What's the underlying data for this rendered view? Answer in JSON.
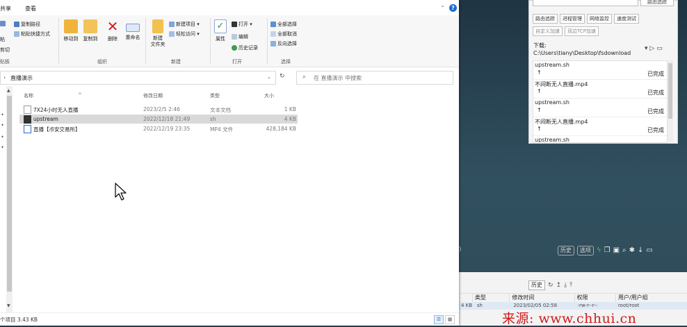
{
  "explorer": {
    "tabs": [
      "共享",
      "查看"
    ],
    "ribbon": {
      "clipboard": {
        "copy_path": "复制路径",
        "paste_shortcut": "粘贴快捷方式",
        "paste_frag": "粘",
        "cut_frag": "剪切",
        "label": "贴板"
      },
      "organize": {
        "move_to": "移动到",
        "copy_to": "复制到",
        "delete": "删除",
        "rename": "重命名",
        "label": "组织"
      },
      "new": {
        "new_item": "新建项目 ▾",
        "easy_access": "轻松访问 ▾",
        "new_folder": "新建\n文件夹",
        "label": "新建"
      },
      "open": {
        "properties": "属性",
        "open": "打开 ▾",
        "edit": "编辑",
        "history": "历史记录",
        "label": "打开"
      },
      "select": {
        "select_all": "全部选择",
        "select_none": "全部取消",
        "invert": "反向选择",
        "label": "选择"
      }
    },
    "address": {
      "path": "直播演示",
      "search_placeholder": "在 直播演示 中搜索"
    },
    "columns": {
      "name": "名称",
      "date": "修改日期",
      "type": "类型",
      "size": "大小"
    },
    "files": [
      {
        "name": "7X24小时无人直播",
        "date": "2023/2/5 2:46",
        "type": "文本文档",
        "size": "1 KB",
        "icon": "text-file-icon",
        "selected": false
      },
      {
        "name": "upstream",
        "date": "2022/12/18 21:49",
        "type": "sh",
        "size": "4 KB",
        "icon": "sh-file-icon",
        "selected": true
      },
      {
        "name": "直播【币安交易所】",
        "date": "2022/12/19 23:35",
        "type": "MP4 文件",
        "size": "428,184 KB",
        "icon": "video-file-icon",
        "selected": false
      }
    ],
    "status": "个项目  3.43 KB"
  },
  "finalshell": {
    "top_button": "路由追踪",
    "tool_row1": [
      "路由追踪",
      "进程管理",
      "网络监控",
      "速度测试"
    ],
    "tool_row2": [
      "自定义加速",
      "双边TCP加速"
    ],
    "download_path": "下载: C:\\Users\\tiany\\Desktop\\fsdownload",
    "downloads": [
      {
        "name": "upstream.sh",
        "status": "已完成"
      },
      {
        "name": "不间断无人直播.mp4",
        "status": "已完成"
      },
      {
        "name": "upstream.sh",
        "status": "已完成"
      },
      {
        "name": "不间断无人直播.mp4",
        "status": "已完成"
      },
      {
        "name": "upstream.sh",
        "status": ""
      }
    ],
    "terminal": {
      "left_text": "i)",
      "history": "历史",
      "options": "选项"
    },
    "file_panel": {
      "history": "历史",
      "columns": [
        "类型",
        "修改时间",
        "权限",
        "用户/用户组"
      ],
      "row": {
        "size": "4 KB",
        "type": "sh",
        "modified": "2023/02/05 02:58",
        "perms": "-rw-r--r--",
        "owner": "root/root"
      }
    }
  },
  "watermark": "来源: www.chhui.cn"
}
